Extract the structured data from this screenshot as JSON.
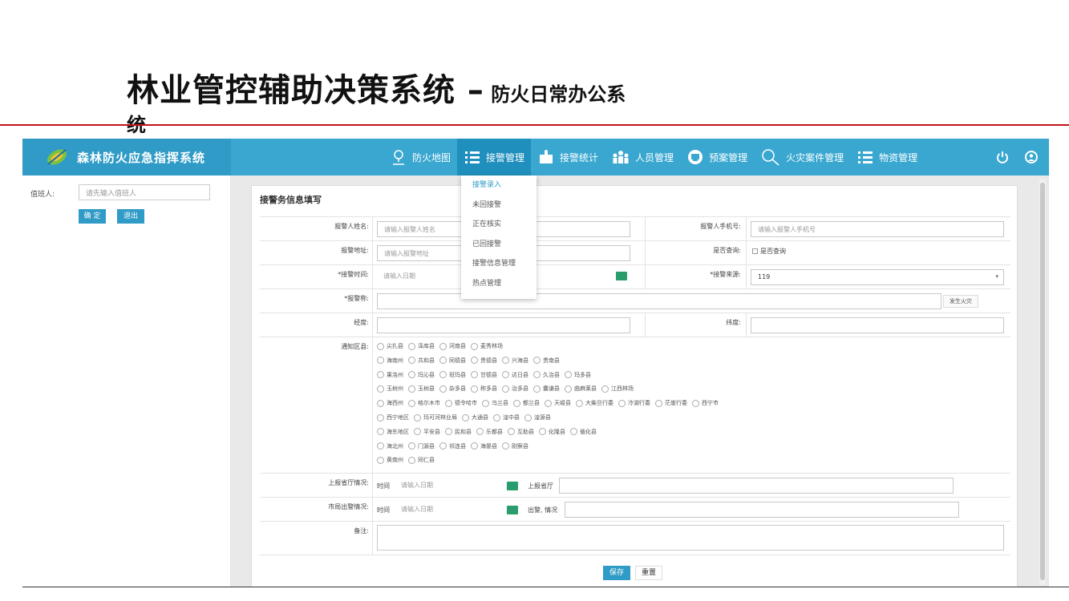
{
  "slide": {
    "title_main": "林业管控辅助决策系统 –",
    "title_sub": " 防火日常办公系",
    "title_tail": "统"
  },
  "app": {
    "brand_name": "森林防火应急指挥系统",
    "nav": [
      {
        "label": "防火地图",
        "icon": "map-pin-icon"
      },
      {
        "label": "接警管理",
        "icon": "list-icon"
      },
      {
        "label": "接警统计",
        "icon": "puzzle-icon"
      },
      {
        "label": "人员管理",
        "icon": "people-icon"
      },
      {
        "label": "预案管理",
        "icon": "plan-icon"
      },
      {
        "label": "火灾案件管理",
        "icon": "search-icon"
      },
      {
        "label": "物资管理",
        "icon": "list-icon"
      }
    ],
    "top_icons": [
      "power-icon",
      "user-icon"
    ]
  },
  "left": {
    "duty_label": "值班人:",
    "duty_placeholder": "请先输入值班人",
    "confirm": "确 定",
    "exit": "退出"
  },
  "dropdown": {
    "options": [
      "接警录入",
      "未回接警",
      "正在核实",
      "已回接警",
      "接警信息管理",
      "热点管理"
    ]
  },
  "form": {
    "panel_title": "接警务信息填写",
    "reporter_name_label": "报警人姓名:",
    "reporter_name_ph": "请输入报警人姓名",
    "reporter_phone_label": "报警人手机号:",
    "reporter_phone_ph": "请输入报警人手机号",
    "address_label": "报警地址:",
    "address_ph": "请输入报警地址",
    "query_label": "是否查询:",
    "query_check": "是否查询",
    "time_label": "*接警时间:",
    "time_ph": "请输入日期",
    "source_label": "*接警来源:",
    "source_value": "119",
    "name_label": "*报警称:",
    "fire_btn": "发生火灾",
    "lng_label": "经度:",
    "lat_label": "纬度:",
    "area_label": "通知区县:",
    "area_rows": [
      [
        "尖扎县",
        "泽库县",
        "河南县",
        "麦秀林场"
      ],
      [
        "海南州",
        "共和县",
        "同德县",
        "贵德县",
        "兴海县",
        "贵南县"
      ],
      [
        "果洛州",
        "玛沁县",
        "班玛县",
        "甘德县",
        "达日县",
        "久治县",
        "玛多县"
      ],
      [
        "玉树州",
        "玉树县",
        "杂多县",
        "称多县",
        "治多县",
        "囊谦县",
        "曲麻莱县",
        "江西林场"
      ],
      [
        "海西州",
        "格尔木市",
        "德令哈市",
        "乌兰县",
        "都兰县",
        "天峻县",
        "大柴旦行委",
        "冷湖行委",
        "茫崖行委",
        "西宁市"
      ],
      [
        "西宁地区",
        "玛可河林业局",
        "大通县",
        "湟中县",
        "湟源县"
      ],
      [
        "海东地区",
        "平安县",
        "民和县",
        "乐都县",
        "互助县",
        "化隆县",
        "循化县"
      ],
      [
        "海北州",
        "门源县",
        "祁连县",
        "海晏县",
        "刚察县"
      ],
      [
        "黄南州",
        "同仁县"
      ]
    ],
    "province_label": "上报省厅情况:",
    "province_time": "时间",
    "province_date_ph": "请输入日期",
    "province_to": "上报省厅",
    "bureau_label": "市局出警情况:",
    "bureau_time": "时间",
    "bureau_date_ph": "请输入日期",
    "bureau_out": "出警, 情况",
    "remark_label": "备注:",
    "save": "保存",
    "reset": "重置"
  }
}
